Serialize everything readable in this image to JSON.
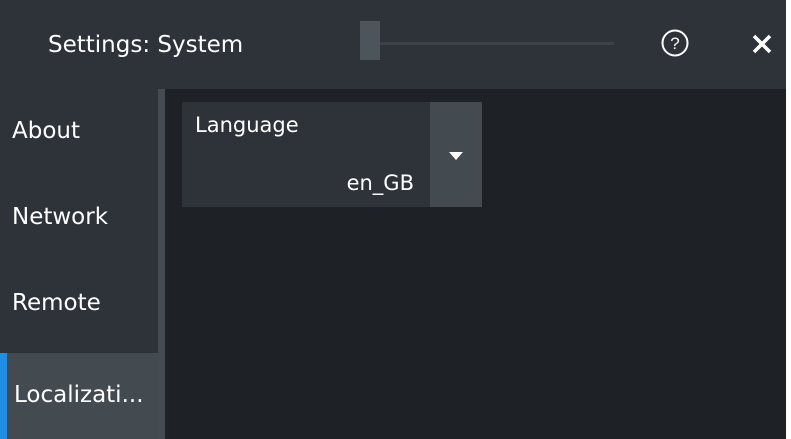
{
  "window": {
    "title": "Settings: System"
  },
  "icons": {
    "help": "help-icon",
    "close": "close-icon",
    "dropdown": "chevron-down-icon"
  },
  "colors": {
    "background": "#1e2226",
    "panel": "#2d3338",
    "accent": "#1e8fe6"
  },
  "sidebar": {
    "items": [
      {
        "label": "About",
        "active": false
      },
      {
        "label": "Network",
        "active": false
      },
      {
        "label": "Remote",
        "active": false
      },
      {
        "label": "Localizati...",
        "active": true
      }
    ]
  },
  "language": {
    "label": "Language",
    "value": "en_GB"
  }
}
